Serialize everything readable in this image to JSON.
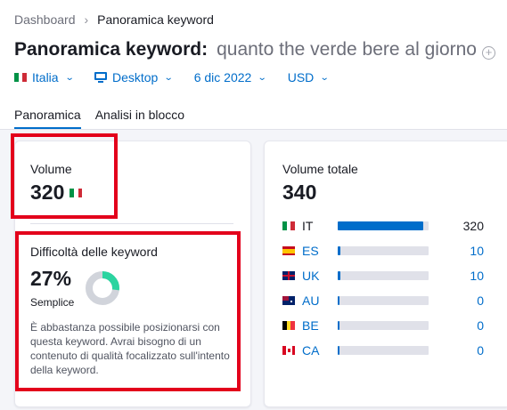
{
  "breadcrumb": {
    "root": "Dashboard",
    "current": "Panoramica keyword"
  },
  "header": {
    "title": "Panoramica keyword:",
    "keyword": "quanto the verde bere al giorno"
  },
  "filters": {
    "database": "Italia",
    "device": "Desktop",
    "date": "6 dic 2022",
    "currency": "USD"
  },
  "tabs": [
    {
      "label": "Panoramica",
      "active": true
    },
    {
      "label": "Analisi in blocco",
      "active": false
    }
  ],
  "volume": {
    "label": "Volume",
    "value": "320"
  },
  "keyword_difficulty": {
    "label": "Difficoltà delle keyword",
    "value": "27%",
    "percent": 27,
    "level": "Semplice",
    "description": "È abbastanza possibile posizionarsi con questa keyword. Avrai bisogno di un contenuto di qualità focalizzato sull'intento della keyword."
  },
  "total_volume": {
    "label": "Volume totale",
    "value": "340",
    "countries": [
      {
        "code": "IT",
        "value": "320",
        "share": 0.94
      },
      {
        "code": "ES",
        "value": "10",
        "share": 0.03
      },
      {
        "code": "UK",
        "value": "10",
        "share": 0.03
      },
      {
        "code": "AU",
        "value": "0",
        "share": 0.0
      },
      {
        "code": "BE",
        "value": "0",
        "share": 0.0
      },
      {
        "code": "CA",
        "value": "0",
        "share": 0.0
      }
    ]
  },
  "colors": {
    "accent": "#006dca",
    "highlight": "#e3001b",
    "kd_green": "#2bd4a0"
  }
}
